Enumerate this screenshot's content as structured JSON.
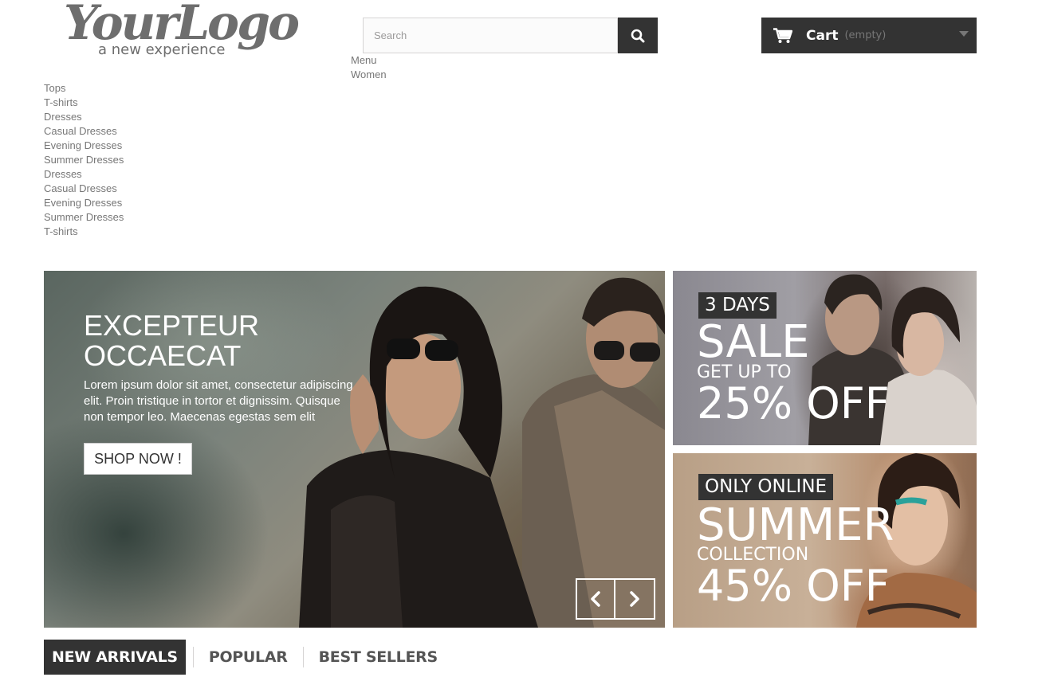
{
  "header": {
    "logo": {
      "script": "YourLogo",
      "tagline": "a new experience"
    },
    "search": {
      "placeholder": "Search",
      "value": "",
      "icon": "search-icon"
    },
    "cart": {
      "label": "Cart",
      "status": "(empty)",
      "icon": "cart-icon",
      "caret_icon": "caret-down-icon"
    }
  },
  "top_menu": {
    "items": [
      "Menu",
      "Women"
    ]
  },
  "categories": [
    "Tops",
    "T-shirts",
    "Dresses",
    "Casual Dresses",
    "Evening Dresses",
    "Summer Dresses",
    "Dresses",
    "Casual Dresses",
    "Evening Dresses",
    "Summer Dresses",
    "T-shirts"
  ],
  "slider": {
    "title": "EXCEPTEUR OCCAECAT",
    "text": "Lorem ipsum dolor sit amet, consectetur adipiscing elit. Proin tristique in tortor et dignissim. Quisque non tempor leo. Maecenas egestas sem elit",
    "button": "SHOP NOW !",
    "prev_icon": "chevron-left-icon",
    "next_icon": "chevron-right-icon"
  },
  "promos": [
    {
      "tag": "3 DAYS",
      "headline": "SALE",
      "sub": "GET UP TO",
      "offer": "25% OFF"
    },
    {
      "tag": "ONLY ONLINE",
      "headline": "SUMMER",
      "sub": "COLLECTION",
      "offer": "45% OFF"
    }
  ],
  "tabs": [
    {
      "label": "NEW ARRIVALS",
      "active": true
    },
    {
      "label": "POPULAR",
      "active": false
    },
    {
      "label": "BEST SELLERS",
      "active": false
    }
  ],
  "colors": {
    "dark": "#333333",
    "link_gray": "#777777",
    "white": "#ffffff"
  }
}
